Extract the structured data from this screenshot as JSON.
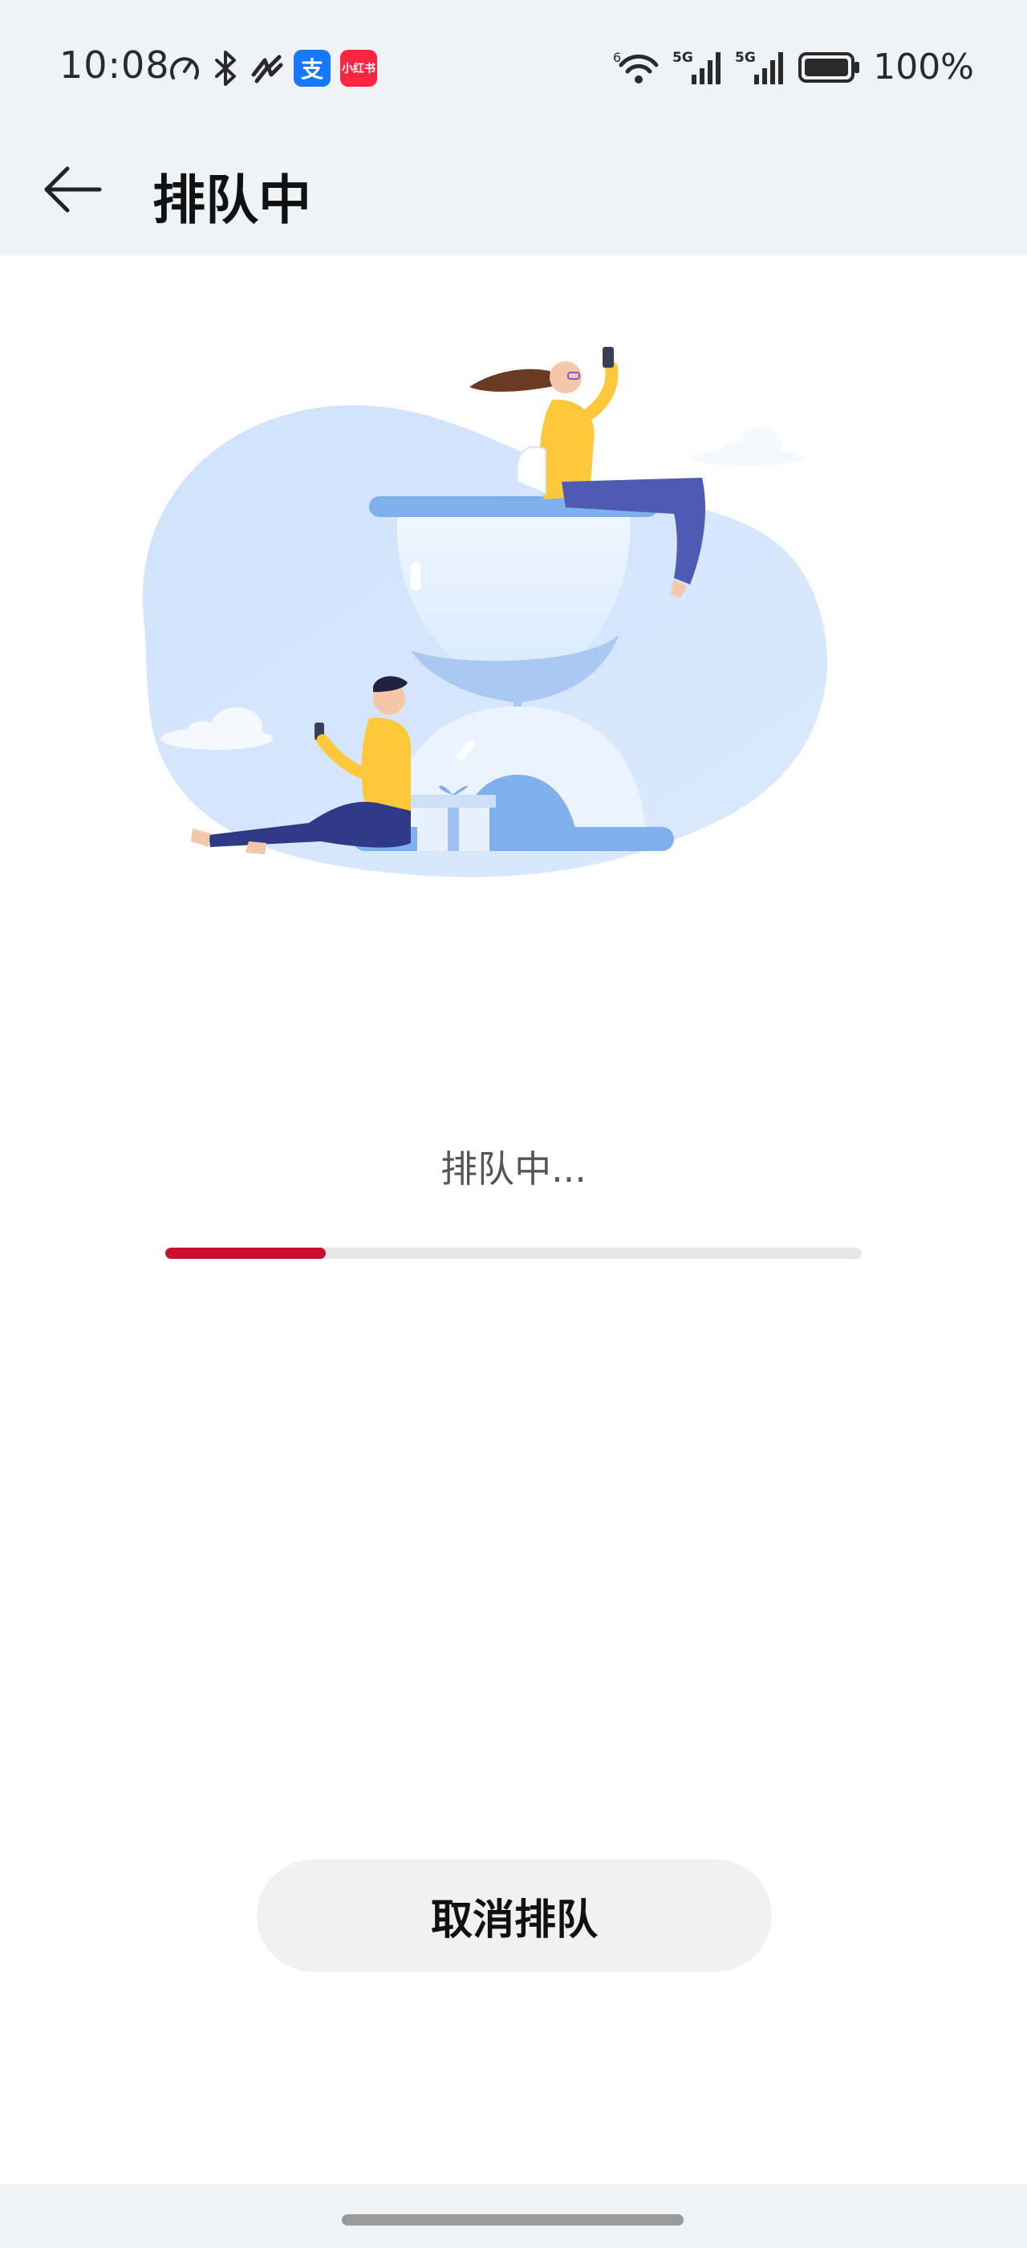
{
  "status_bar": {
    "time": "10:08",
    "battery": "100%",
    "signal_1": "5G",
    "signal_2": "5G",
    "wifi_badge": "6",
    "left_icons": [
      "speedometer-icon",
      "bluetooth-icon",
      "nfc-icon",
      "alipay-app-icon",
      "xiaohongshu-app-icon"
    ],
    "right_icons": [
      "wifi-icon",
      "signal-icon",
      "signal-icon",
      "battery-icon"
    ],
    "alipay_glyph": "支",
    "xhs_glyph": "小红书"
  },
  "nav": {
    "title": "排队中",
    "back_icon": "arrow-left-icon"
  },
  "queue": {
    "status_text": "排队中...",
    "progress": 0.23,
    "progress_color": "#c8102e"
  },
  "actions": {
    "cancel_label": "取消排队"
  },
  "colors": {
    "background": "#ffffff",
    "bars": "#f1f2f4",
    "accent": "#c8102e"
  }
}
